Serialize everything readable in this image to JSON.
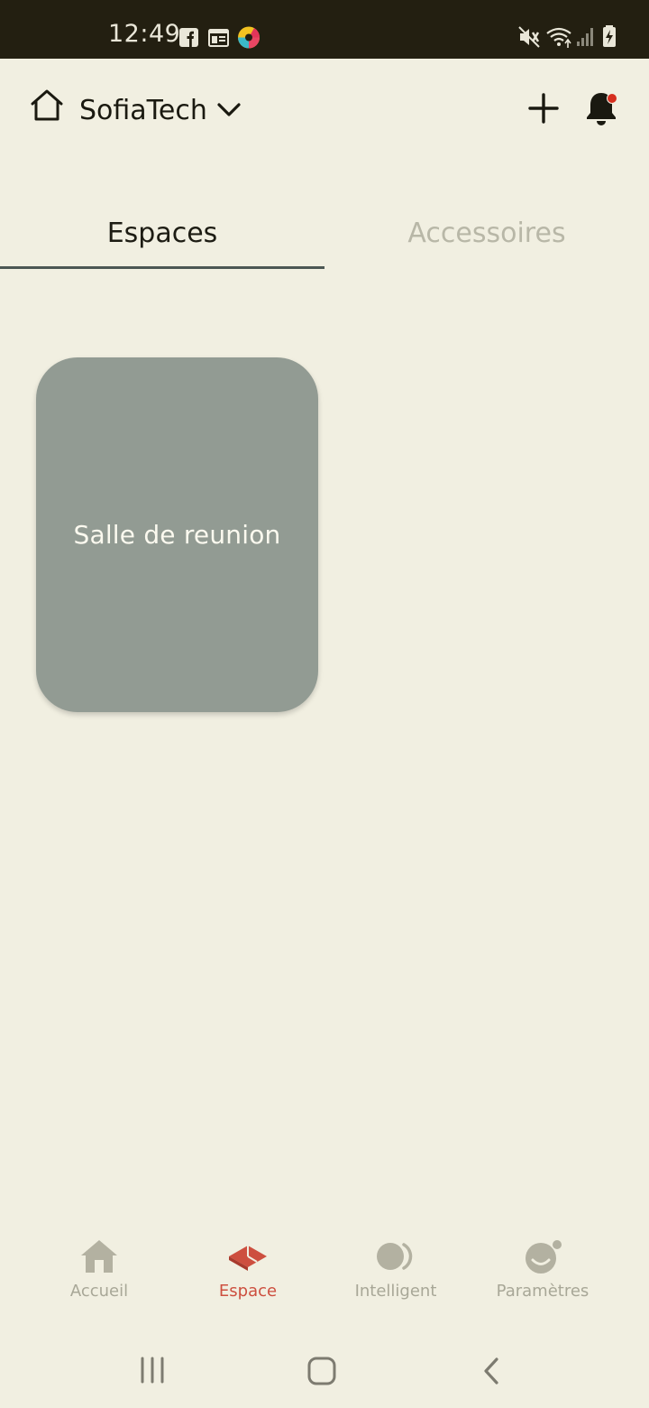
{
  "status_bar": {
    "time": "12:49",
    "icons": [
      "facebook-icon",
      "calendar-icon",
      "color-app-icon",
      "mute-icon",
      "wifi-icon",
      "signal-icon",
      "battery-charging-icon"
    ]
  },
  "header": {
    "home_name": "SofiaTech",
    "icons": [
      "home-icon",
      "chevron-down-icon",
      "plus-icon",
      "bell-icon"
    ]
  },
  "tabs": [
    {
      "label": "Espaces",
      "active": true
    },
    {
      "label": "Accessoires",
      "active": false
    }
  ],
  "spaces": [
    {
      "name": "Salle de reunion"
    }
  ],
  "bottom_nav": [
    {
      "label": "Accueil",
      "icon": "house-icon",
      "active": false
    },
    {
      "label": "Espace",
      "icon": "space-icon",
      "active": true
    },
    {
      "label": "Intelligent",
      "icon": "intelligent-icon",
      "active": false
    },
    {
      "label": "Paramètres",
      "icon": "settings-face-icon",
      "active": false
    }
  ],
  "colors": {
    "background": "#f1efe1",
    "status_bar": "#231f11",
    "card": "#929b93",
    "accent": "#cd4f3f",
    "inactive": "#a8a797",
    "notification_dot": "#d62f1f"
  },
  "system_nav": [
    "recents-button",
    "home-button",
    "back-button"
  ]
}
